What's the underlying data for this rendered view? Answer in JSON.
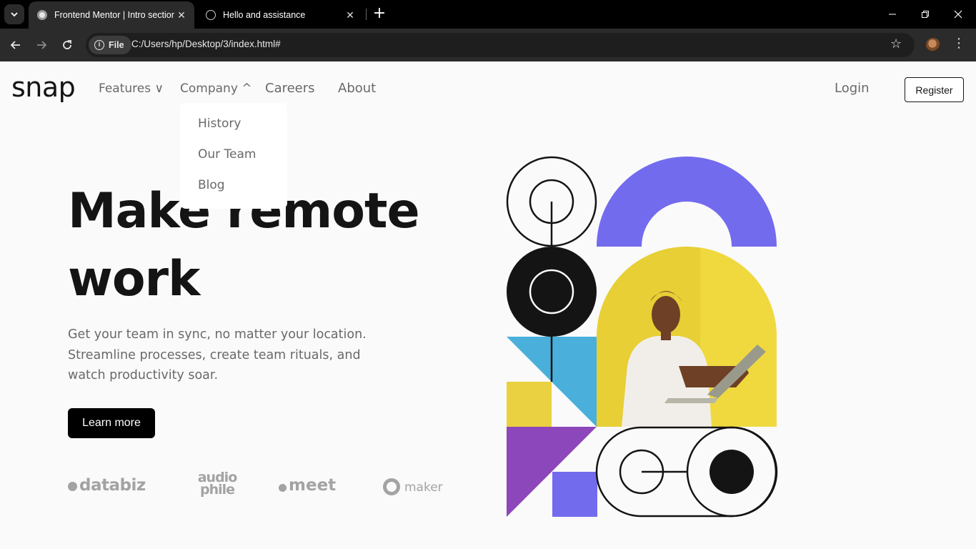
{
  "browser": {
    "tabs": [
      {
        "title": "Frontend Mentor | Intro section",
        "active": true
      },
      {
        "title": "Hello and assistance",
        "active": false
      }
    ],
    "address": {
      "scheme_label": "File",
      "url": "C:/Users/hp/Desktop/3/index.html#"
    }
  },
  "site": {
    "logo": "snap",
    "nav": [
      {
        "label": "Features ∨"
      },
      {
        "label": "Company ^"
      },
      {
        "label": "Careers"
      },
      {
        "label": "About"
      }
    ],
    "login": "Login",
    "register": "Register",
    "company_dropdown": [
      "History",
      "Our Team",
      "Blog"
    ]
  },
  "hero": {
    "title_line1": "Make remote",
    "title_line2": "work",
    "subtitle": "Get your team in sync, no matter your location. Streamline processes, create team rituals, and watch productivity soar.",
    "cta": "Learn more"
  },
  "clients": [
    "databiz",
    "audio phile",
    "meet",
    "maker"
  ],
  "colors": {
    "purple": "#736bee",
    "yellow": "#e9d141",
    "blue": "#4ab0db",
    "violet": "#8c48ba",
    "black": "#141414",
    "gray_text": "#696969"
  }
}
